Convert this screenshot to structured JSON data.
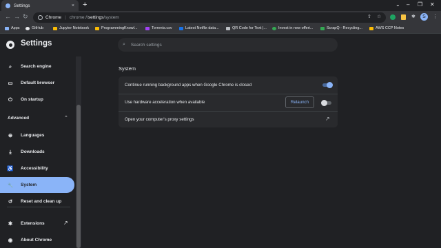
{
  "browser": {
    "tab_title": "Settings",
    "tab_close": "×",
    "new_tab": "+",
    "window_controls": [
      "⌄",
      "–",
      "❐",
      "✕"
    ],
    "nav": {
      "back": "←",
      "forward": "→",
      "reload": "↻"
    },
    "omnibox": {
      "site_name": "Chrome",
      "scheme": "chrome://",
      "host": "settings",
      "path": "/system"
    }
  },
  "bookmarks": [
    {
      "label": "Apps",
      "color": "#8ab4f8"
    },
    {
      "label": "GitHub",
      "color": "#e8eaed"
    },
    {
      "label": "Jupyter Notebook",
      "color": "#fbbc04"
    },
    {
      "label": "ProgrammingKnowl...",
      "color": "#fbbc04"
    },
    {
      "label": "Torrents.csv",
      "color": "#a142f4"
    },
    {
      "label": "Latest Netflix data...",
      "color": "#1a73e8"
    },
    {
      "label": "QR Code for Text |...",
      "color": "#bdc1c6"
    },
    {
      "label": "Invest in new offeri...",
      "color": "#34a853"
    },
    {
      "label": "ScrapQ - Recycling...",
      "color": "#34a853"
    },
    {
      "label": "AWS CCP Notes",
      "color": "#fbbc04"
    }
  ],
  "settings": {
    "title": "Settings",
    "search_placeholder": "Search settings"
  },
  "sidebar": {
    "items": [
      {
        "label": "Search engine",
        "icon": "search-icon",
        "glyph": "⌕"
      },
      {
        "label": "Default browser",
        "icon": "browser-icon",
        "glyph": "▭"
      },
      {
        "label": "On startup",
        "icon": "power-icon",
        "glyph": "⏻"
      },
      {
        "label": "Languages",
        "icon": "globe-icon",
        "glyph": "⊕"
      },
      {
        "label": "Downloads",
        "icon": "download-icon",
        "glyph": "⤓"
      },
      {
        "label": "Accessibility",
        "icon": "accessibility-icon",
        "glyph": "♿"
      },
      {
        "label": "System",
        "icon": "wrench-icon",
        "glyph": "🔧"
      },
      {
        "label": "Reset and clean up",
        "icon": "reset-icon",
        "glyph": "↺"
      },
      {
        "label": "Extensions",
        "icon": "puzzle-icon",
        "glyph": "✱"
      },
      {
        "label": "About Chrome",
        "icon": "chrome-icon",
        "glyph": "◉"
      }
    ],
    "advanced_label": "Advanced",
    "advanced_chevron": "⌃",
    "external_icon": "↗",
    "active_color": "#8ab4f8"
  },
  "main": {
    "section_title": "System",
    "rows": {
      "background_apps": {
        "label": "Continue running background apps when Google Chrome is closed",
        "enabled": true
      },
      "hardware_accel": {
        "label": "Use hardware acceleration when available",
        "enabled": false,
        "button": "Relaunch"
      },
      "proxy": {
        "label": "Open your computer's proxy settings",
        "icon": "external-link-icon",
        "glyph": "↗"
      }
    }
  }
}
